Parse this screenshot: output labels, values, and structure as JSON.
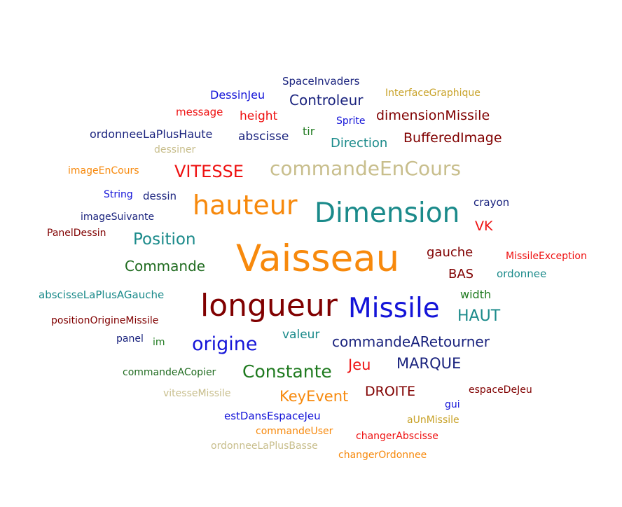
{
  "word_cloud": {
    "words": [
      {
        "text": "Vaisseau",
        "color": "#f7890c"
      },
      {
        "text": "longueur",
        "color": "#800000"
      },
      {
        "text": "Missile",
        "color": "#1414d8"
      },
      {
        "text": "Dimension",
        "color": "#1a8a8a"
      },
      {
        "text": "hauteur",
        "color": "#f7890c"
      },
      {
        "text": "commandeEnCours",
        "color": "#c8be8c"
      },
      {
        "text": "origine",
        "color": "#1414d8"
      },
      {
        "text": "Constante",
        "color": "#1f7a1f"
      },
      {
        "text": "VITESSE",
        "color": "#ee1111"
      },
      {
        "text": "Position",
        "color": "#1a8a8a"
      },
      {
        "text": "Commande",
        "color": "#1f6b1f"
      },
      {
        "text": "commandeARetourner",
        "color": "#1a237e"
      },
      {
        "text": "KeyEvent",
        "color": "#f7890c"
      },
      {
        "text": "MARQUE",
        "color": "#1a237e"
      },
      {
        "text": "HAUT",
        "color": "#1a8a8a"
      },
      {
        "text": "Jeu",
        "color": "#ee1111"
      },
      {
        "text": "DROITE",
        "color": "#800000"
      },
      {
        "text": "BufferedImage",
        "color": "#800000"
      },
      {
        "text": "dimensionMissile",
        "color": "#800000"
      },
      {
        "text": "Controleur",
        "color": "#1a237e"
      },
      {
        "text": "Direction",
        "color": "#1a8a8a"
      },
      {
        "text": "gauche",
        "color": "#800000"
      },
      {
        "text": "BAS",
        "color": "#800000"
      },
      {
        "text": "VK",
        "color": "#ee1111"
      },
      {
        "text": "ordonneeLaPlusHaute",
        "color": "#1a237e"
      },
      {
        "text": "abscisse",
        "color": "#1a237e"
      },
      {
        "text": "valeur",
        "color": "#1a8a8a"
      },
      {
        "text": "DessinJeu",
        "color": "#1414d8"
      },
      {
        "text": "height",
        "color": "#ee1111"
      },
      {
        "text": "message",
        "color": "#ee1111"
      },
      {
        "text": "abscisseLaPlusAGauche",
        "color": "#1a8a8a"
      },
      {
        "text": "width",
        "color": "#1f7a1f"
      },
      {
        "text": "SpaceInvaders",
        "color": "#1a237e"
      },
      {
        "text": "crayon",
        "color": "#1a237e"
      },
      {
        "text": "ordonnee",
        "color": "#1a8a8a"
      },
      {
        "text": "estDansEspaceJeu",
        "color": "#1414d8"
      },
      {
        "text": "imageSuivante",
        "color": "#1a237e"
      },
      {
        "text": "commandeACopier",
        "color": "#1f6b1f"
      },
      {
        "text": "positionOrigineMissile",
        "color": "#800000"
      },
      {
        "text": "changerAbscisse",
        "color": "#ee1111"
      },
      {
        "text": "changerOrdonnee",
        "color": "#f7890c"
      },
      {
        "text": "ordonneeLaPlusBasse",
        "color": "#c8be8c"
      },
      {
        "text": "commandeUser",
        "color": "#f7890c"
      },
      {
        "text": "vitesseMissile",
        "color": "#c8be8c"
      },
      {
        "text": "espaceDeJeu",
        "color": "#800000"
      },
      {
        "text": "MissileException",
        "color": "#ee1111"
      },
      {
        "text": "InterfaceGraphique",
        "color": "#c8a228"
      },
      {
        "text": "imageEnCours",
        "color": "#f7890c"
      },
      {
        "text": "PanelDessin",
        "color": "#800000"
      },
      {
        "text": "String",
        "color": "#1414d8"
      },
      {
        "text": "dessin",
        "color": "#1a237e"
      },
      {
        "text": "dessiner",
        "color": "#c8be8c"
      },
      {
        "text": "tir",
        "color": "#1f7a1f"
      },
      {
        "text": "Sprite",
        "color": "#1414d8"
      },
      {
        "text": "panel",
        "color": "#1a237e"
      },
      {
        "text": "im",
        "color": "#1f7a1f"
      },
      {
        "text": "gui",
        "color": "#1414d8"
      },
      {
        "text": "aUnMissile",
        "color": "#c8a228"
      }
    ]
  }
}
